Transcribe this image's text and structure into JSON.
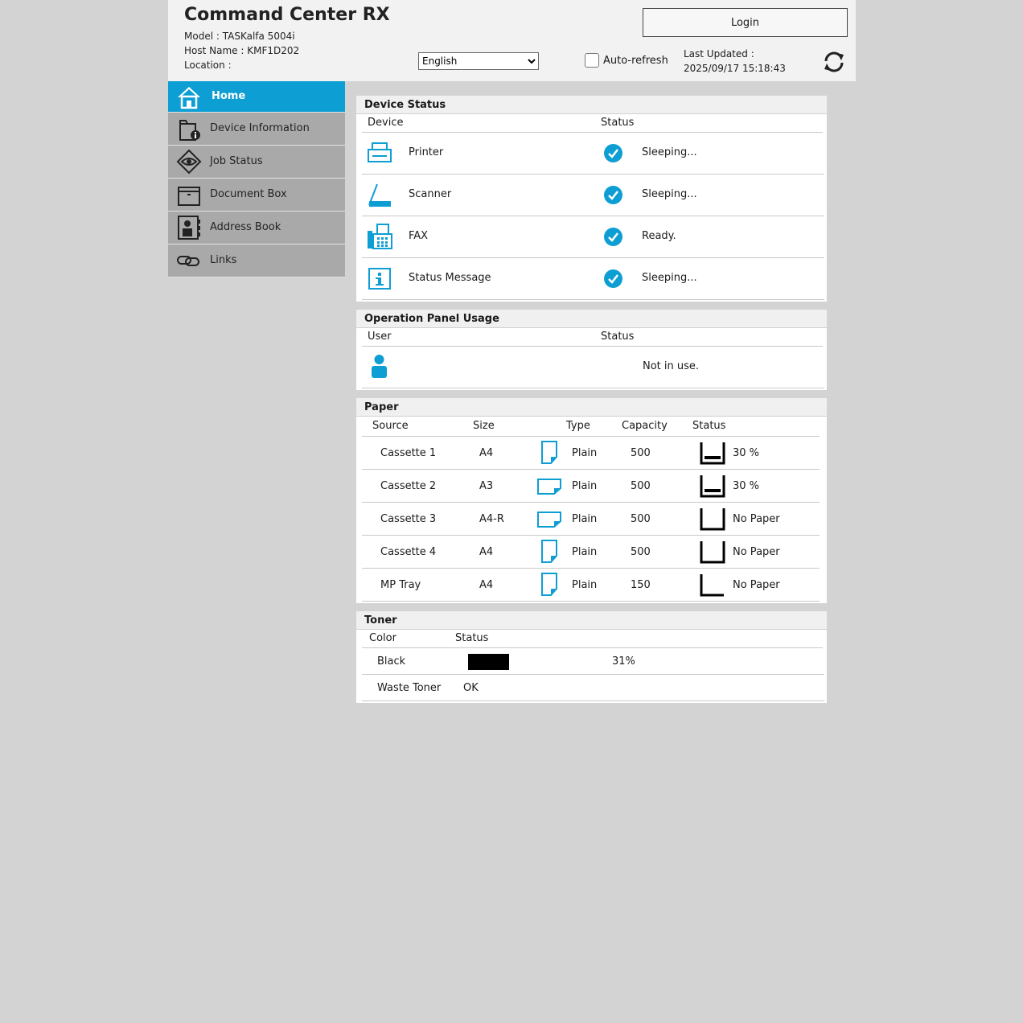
{
  "header": {
    "title": "Command Center RX",
    "model_label": "Model :",
    "model_value": "TASKalfa 5004i",
    "host_label": "Host Name :",
    "host_value": "KMF1D202",
    "location_label": "Location :",
    "location_value": "",
    "language_selected": "English",
    "auto_refresh_label": "Auto-refresh",
    "auto_refresh_checked": false,
    "last_updated_label": "Last Updated :",
    "last_updated_value": "2025/09/17 15:18:43",
    "login_label": "Login"
  },
  "sidebar": {
    "items": [
      {
        "label": "Home",
        "icon": "home-icon",
        "active": true
      },
      {
        "label": "Device Information",
        "icon": "device-information-icon"
      },
      {
        "label": "Job Status",
        "icon": "eye-icon"
      },
      {
        "label": "Document Box",
        "icon": "folder-icon"
      },
      {
        "label": "Address Book",
        "icon": "address-book-icon"
      },
      {
        "label": "Links",
        "icon": "link-icon"
      }
    ]
  },
  "device_status": {
    "title": "Device Status",
    "col_device": "Device",
    "col_status": "Status",
    "rows": [
      {
        "device": "Printer",
        "icon": "printer-icon",
        "status": "Sleeping..."
      },
      {
        "device": "Scanner",
        "icon": "scanner-icon",
        "status": "Sleeping..."
      },
      {
        "device": "FAX",
        "icon": "fax-icon",
        "status": "Ready."
      },
      {
        "device": "Status Message",
        "icon": "info-icon",
        "status": "Sleeping..."
      }
    ]
  },
  "operation_panel": {
    "title": "Operation Panel Usage",
    "col_user": "User",
    "col_status": "Status",
    "status": "Not in use."
  },
  "paper": {
    "title": "Paper",
    "col_source": "Source",
    "col_size": "Size",
    "col_type": "Type",
    "col_capacity": "Capacity",
    "col_status": "Status",
    "rows": [
      {
        "source": "Cassette 1",
        "size": "A4",
        "orientation": "portrait",
        "type": "Plain",
        "capacity": "500",
        "status": "30 %",
        "level": 0.3
      },
      {
        "source": "Cassette 2",
        "size": "A3",
        "orientation": "landscape",
        "type": "Plain",
        "capacity": "500",
        "status": "30 %",
        "level": 0.3
      },
      {
        "source": "Cassette 3",
        "size": "A4-R",
        "orientation": "landscape",
        "type": "Plain",
        "capacity": "500",
        "status": "No Paper",
        "level": 0
      },
      {
        "source": "Cassette 4",
        "size": "A4",
        "orientation": "portrait",
        "type": "Plain",
        "capacity": "500",
        "status": "No Paper",
        "level": 0
      },
      {
        "source": "MP Tray",
        "size": "A4",
        "orientation": "portrait",
        "type": "Plain",
        "capacity": "150",
        "status": "No Paper",
        "level": 0,
        "tray": "mp"
      }
    ]
  },
  "toner": {
    "title": "Toner",
    "col_color": "Color",
    "col_status": "Status",
    "black_label": "Black",
    "black_level": "31%",
    "black_fraction": 0.31,
    "waste_label": "Waste Toner",
    "waste_status": "OK"
  },
  "colors": {
    "accent": "#0d9ed3",
    "sidebar_bg": "#a9a9a9",
    "page_bg": "#d3d3d3"
  }
}
